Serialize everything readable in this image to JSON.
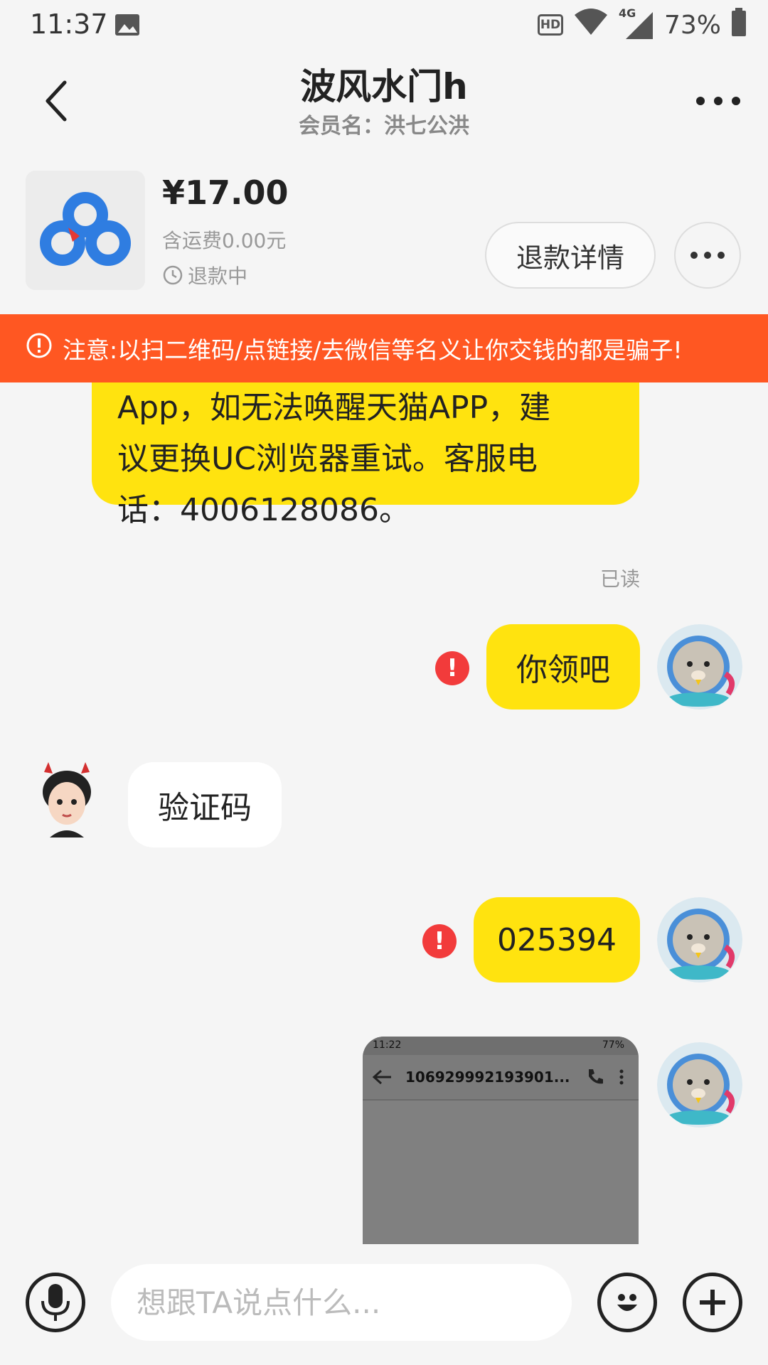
{
  "status_bar": {
    "time": "11:37",
    "hd": "HD",
    "network": "4G",
    "battery": "73%"
  },
  "header": {
    "title": "波风水门h",
    "subtitle": "会员名：洪七公洪"
  },
  "product": {
    "price": "¥17.00",
    "shipping": "含运费0.00元",
    "refund_status": "退款中",
    "refund_button": "退款详情"
  },
  "warning": {
    "text": "注意:以扫二维码/点链接/去微信等名义让你交钱的都是骗子!"
  },
  "messages": {
    "long_text_line1": "App，如无法唤醒天猫APP，建",
    "long_text_line2": "议更换UC浏览器重试。客服电",
    "long_text_line3": "话：4006128086。",
    "read_label": "已读",
    "msg1": "你领吧",
    "msg2": "验证码",
    "msg3": "025394",
    "screenshot": {
      "time": "11:22",
      "battery": "77%",
      "title": "106929992193901..."
    }
  },
  "input": {
    "placeholder": "想跟TA说点什么..."
  },
  "colors": {
    "accent_yellow": "#ffe30f",
    "warning_orange": "#ff5722",
    "error_red": "#f23b3b"
  }
}
